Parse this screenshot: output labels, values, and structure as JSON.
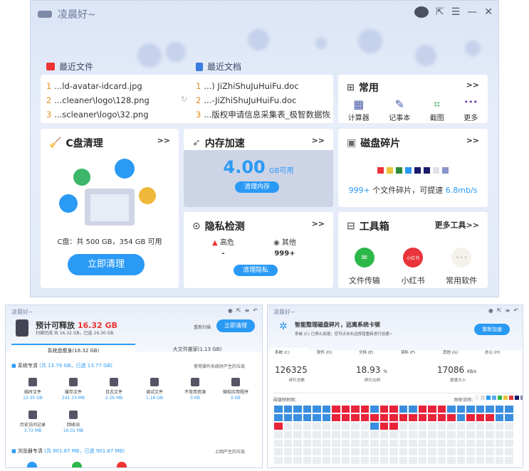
{
  "app": {
    "title": "凌晨好~"
  },
  "recent_files": {
    "label": "最近文件",
    "items": [
      {
        "n": "1",
        "name": "...ld-avatar-idcard.jpg"
      },
      {
        "n": "2",
        "name": "...cleaner\\logo\\128.png"
      },
      {
        "n": "3",
        "name": "...scleaner\\logo\\32.png"
      }
    ]
  },
  "recent_docs": {
    "label": "最近文档",
    "items": [
      {
        "n": "1",
        "name": "...) JiZhiShuJuHuiFu.doc"
      },
      {
        "n": "2",
        "name": "...-JiZhiShuJuHuiFu.doc"
      },
      {
        "n": "3",
        "name": "...版权申请信息采集表_极智数据恢复"
      }
    ]
  },
  "common": {
    "title": "常用",
    "more": ">>",
    "tools": [
      {
        "icon": "calculator-icon",
        "glyph": "▦",
        "label": "计算器"
      },
      {
        "icon": "notepad-icon",
        "glyph": "✎",
        "label": "记事本"
      },
      {
        "icon": "screenshot-icon",
        "glyph": "⌗",
        "label": "截图"
      },
      {
        "icon": "more-icon",
        "glyph": "•••",
        "label": "更多"
      }
    ]
  },
  "c_clean": {
    "title": "C盘清理",
    "more": ">>",
    "disk_info": "C盘：共 500 GB，354 GB 可用",
    "button": "立即清理"
  },
  "memory": {
    "title": "内存加速",
    "more": ">>",
    "value": "4.00",
    "unit": "GB可用",
    "button": "清理内存"
  },
  "frag": {
    "title": "磁盘碎片",
    "more": ">>",
    "count_prefix": "999+",
    "count_text": "个文件碎片，可提速",
    "speed": "6.8mb/s",
    "colors": [
      "#e8343a",
      "#e8c53a",
      "#2a8a3a",
      "#2a9af5",
      "#1a1a6a",
      "#1a1a6a",
      "#e0e0e8",
      "#8a93c8"
    ]
  },
  "privacy": {
    "title": "隐私检测",
    "more": ">>",
    "high_label": "高危",
    "high_value": "-",
    "other_label": "其他",
    "other_value": "999+",
    "button": "清理隐私"
  },
  "toolbox": {
    "title": "工具箱",
    "more": "更多工具>>",
    "apps": [
      {
        "label": "文件传输",
        "color": "#2db84a",
        "glyph": "✉"
      },
      {
        "label": "小红书",
        "color": "#e8343a",
        "glyph": "小红书"
      },
      {
        "label": "常用软件",
        "color": "#f0ede6",
        "glyph": "•••"
      }
    ]
  },
  "shot1": {
    "title": "凌晨好~",
    "release_label": "预计可释放",
    "release_value": "16.32 GB",
    "scanned": "扫描完成 共 16.32 GB，已选 16.30 GB",
    "rescan": "重新扫描",
    "button": "立即清理",
    "tab1": "系统盘瘦身(16.32 GB)",
    "tab2": "大文件搬家(1.13 GB)",
    "sec_title": "系统专清",
    "sec_meta": "(共 13.79 GB，已选 13.77 GB)",
    "sec_hint": "使用操作系统时产生的垃圾",
    "items": [
      {
        "l": "临时文件",
        "v": "12.35 GB"
      },
      {
        "l": "缓存文件",
        "v": "241.33 MB"
      },
      {
        "l": "日志文件",
        "v": "2.26 MB"
      },
      {
        "l": "调试文件",
        "v": "1.18 GB"
      },
      {
        "l": "不常用资源",
        "v": "0 KB"
      },
      {
        "l": "微软应用程序",
        "v": "0 KB"
      },
      {
        "l": "历史访问记录",
        "v": "3.72 MB"
      },
      {
        "l": "回收站",
        "v": "16.01 MB"
      }
    ],
    "sec2_title": "浏览器专清",
    "sec2_meta": "(共 901.87 MB，已选 901.87 MB)",
    "sec2_hint": "上网产生的垃圾"
  },
  "shot2": {
    "title": "凌晨好~",
    "headline": "智能整理磁盘碎片，远离系统卡顿",
    "sub": "系统 (C) 已停止加速，您可点击右边按钮重新进行加速~",
    "button": "重新加速",
    "tabs": [
      "系统 (C)",
      "软件 (D)",
      "文档 (E)",
      "资料 (F)",
      "其他 (G)",
      "办公 (H)"
    ],
    "stats": [
      {
        "v": "126325",
        "u": "",
        "l": "碎片总数"
      },
      {
        "v": "18.93",
        "u": "%",
        "l": "碎片比例"
      },
      {
        "v": "17086",
        "u": "KB/s",
        "l": "提速大小"
      }
    ],
    "map_label": "磁盘映射图：",
    "legend_label": "映射说明："
  }
}
